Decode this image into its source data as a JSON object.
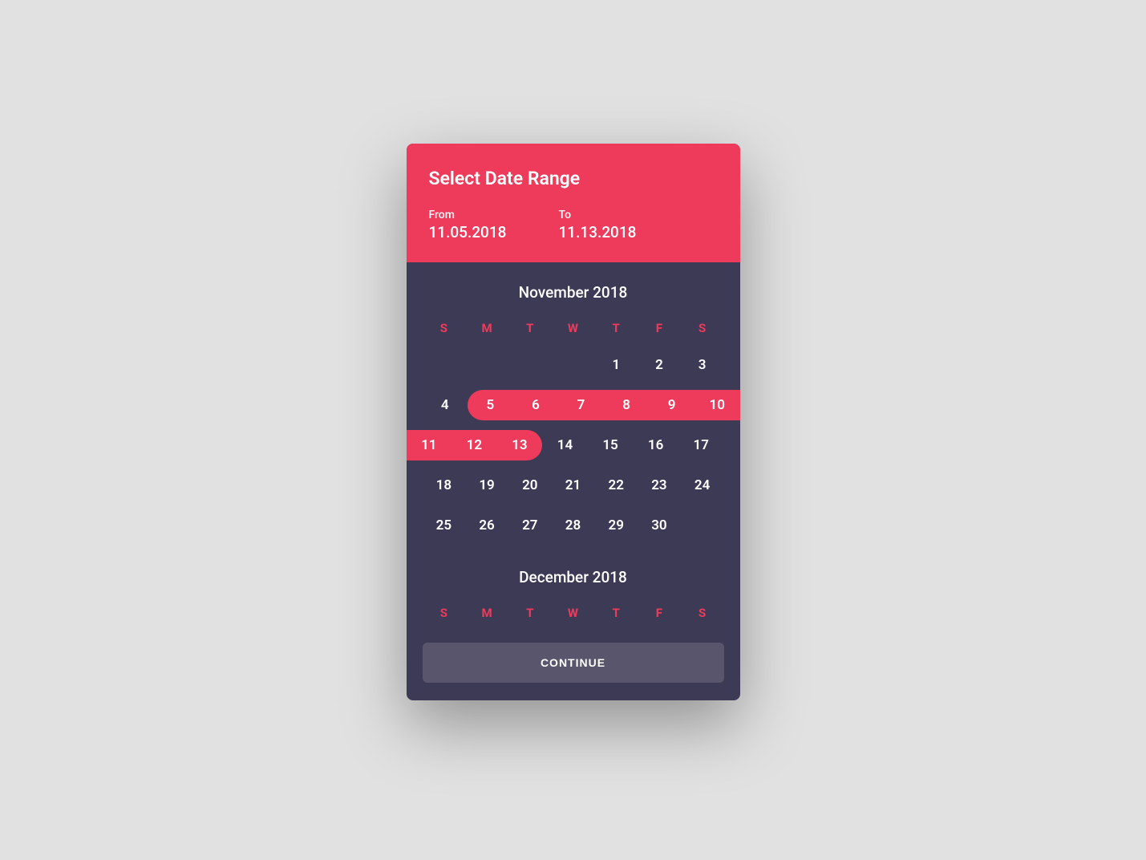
{
  "colors": {
    "accent": "#ee3a5b",
    "panel": "#3d3a56",
    "bg": "#e1e1e1"
  },
  "header": {
    "title": "Select Date Range",
    "from_label": "From",
    "from_value": "11.05.2018",
    "to_label": "To",
    "to_value": "11.13.2018"
  },
  "dow": [
    "S",
    "M",
    "T",
    "W",
    "T",
    "F",
    "S"
  ],
  "months": [
    {
      "title": "November 2018",
      "weeks": [
        [
          {
            "d": ""
          },
          {
            "d": ""
          },
          {
            "d": ""
          },
          {
            "d": ""
          },
          {
            "d": "1",
            "sel": false
          },
          {
            "d": "2",
            "sel": false
          },
          {
            "d": "3",
            "sel": false
          }
        ],
        [
          {
            "d": "4",
            "sel": false
          },
          {
            "d": "5",
            "sel": true,
            "start": true
          },
          {
            "d": "6",
            "sel": true
          },
          {
            "d": "7",
            "sel": true
          },
          {
            "d": "8",
            "sel": true
          },
          {
            "d": "9",
            "sel": true
          },
          {
            "d": "10",
            "sel": true,
            "bleed": "right"
          }
        ],
        [
          {
            "d": "11",
            "sel": true,
            "bleed": "left"
          },
          {
            "d": "12",
            "sel": true
          },
          {
            "d": "13",
            "sel": true,
            "end": true
          },
          {
            "d": "14",
            "sel": false
          },
          {
            "d": "15",
            "sel": false
          },
          {
            "d": "16",
            "sel": false
          },
          {
            "d": "17",
            "sel": false
          }
        ],
        [
          {
            "d": "18",
            "sel": false
          },
          {
            "d": "19",
            "sel": false
          },
          {
            "d": "20",
            "sel": false
          },
          {
            "d": "21",
            "sel": false
          },
          {
            "d": "22",
            "sel": false
          },
          {
            "d": "23",
            "sel": false
          },
          {
            "d": "24",
            "sel": false
          }
        ],
        [
          {
            "d": "25",
            "sel": false
          },
          {
            "d": "26",
            "sel": false
          },
          {
            "d": "27",
            "sel": false
          },
          {
            "d": "28",
            "sel": false
          },
          {
            "d": "29",
            "sel": false
          },
          {
            "d": "30",
            "sel": false
          },
          {
            "d": ""
          }
        ]
      ]
    },
    {
      "title": "December 2018",
      "weeks": []
    }
  ],
  "footer": {
    "continue_label": "CONTINUE"
  }
}
